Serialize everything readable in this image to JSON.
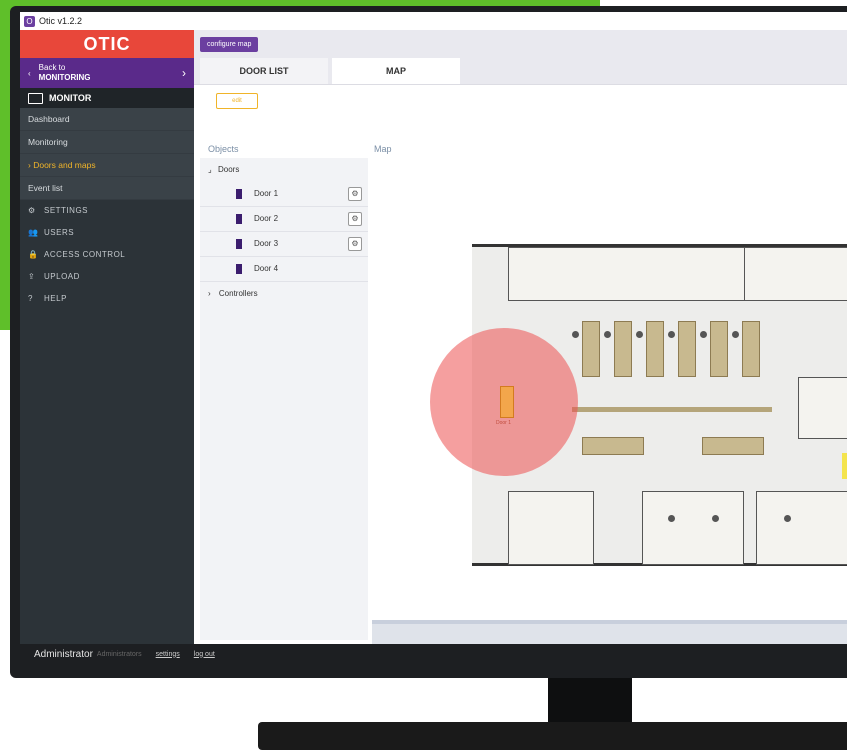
{
  "window": {
    "title": "Otic v1.2.2"
  },
  "brand": {
    "logo": "OTIC",
    "accent": "#e8473a",
    "purple": "#5a2a8a",
    "highlight": "#f0b429"
  },
  "sidebar": {
    "back_line1": "Back to",
    "back_line2": "MONITORING",
    "section": "MONITOR",
    "submenu": [
      {
        "label": "Dashboard"
      },
      {
        "label": "Monitoring"
      },
      {
        "label": "Doors and maps",
        "active": true
      },
      {
        "label": "Event list"
      }
    ],
    "menu": [
      {
        "label": "SETTINGS",
        "icon": "gear-icon"
      },
      {
        "label": "USERS",
        "icon": "users-icon"
      },
      {
        "label": "ACCESS CONTROL",
        "icon": "access-icon"
      },
      {
        "label": "UPLOAD",
        "icon": "upload-icon"
      },
      {
        "label": "HELP",
        "icon": "help-icon"
      }
    ]
  },
  "toolbar": {
    "configure_map": "configure map"
  },
  "tabs": [
    {
      "label": "DOOR LIST"
    },
    {
      "label": "MAP",
      "active": true
    }
  ],
  "edit_label": "edit",
  "objects": {
    "title": "Objects",
    "doors_label": "Doors",
    "doors": [
      {
        "name": "Door 1"
      },
      {
        "name": "Door 2"
      },
      {
        "name": "Door 3"
      },
      {
        "name": "Door 4"
      }
    ],
    "controllers_label": "Controllers"
  },
  "map": {
    "title": "Map",
    "door_marker_label": "Door 1"
  },
  "status": {
    "user": "Administrator",
    "role": "Administrators",
    "settings": "settings",
    "logout": "log out"
  }
}
